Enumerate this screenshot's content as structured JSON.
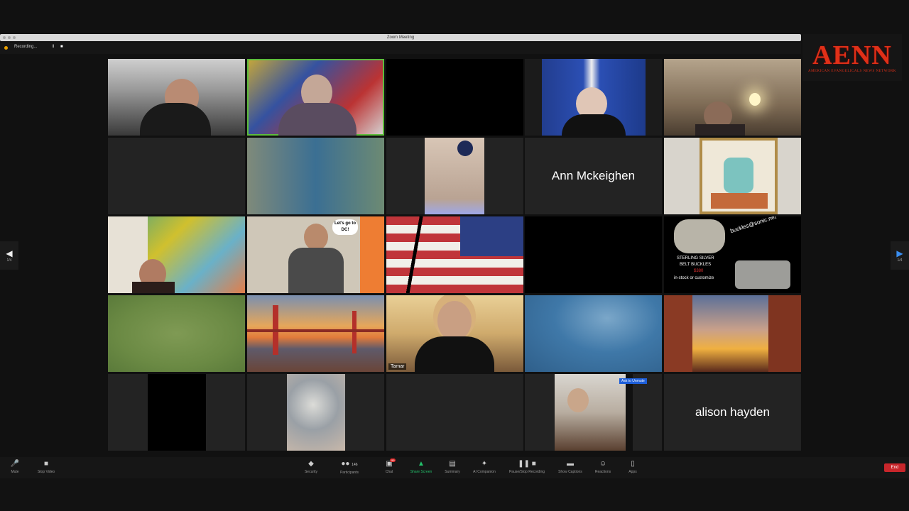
{
  "window": {
    "title": "Zoom Meeting"
  },
  "recording": {
    "label": "Recording...",
    "pause": "‖",
    "stop": "■"
  },
  "logo": {
    "text": "AENN",
    "subtitle": "AMERICAN EVANGELICALS NEWS NETWORK"
  },
  "participants": {
    "ann": "Ann Mckeighen",
    "alison": "alison hayden",
    "tamar_tag": "Tamar",
    "buckle_email": "buckles@sonic.net",
    "buckle_line1": "STERLING SILVER",
    "buckle_line2": "BELT BUCKLES",
    "buckle_price": "$380",
    "buckle_line3": "in-stock or customize",
    "sign_text": "Let's go to DC!",
    "ask_unmute": "Ask to Unmute"
  },
  "nav": {
    "prev_page": "1/4",
    "next_page": "1/4"
  },
  "toolbar": {
    "mute": "Mute",
    "stop_video": "Stop Video",
    "security": "Security",
    "participants": "Participants",
    "participants_count": "146",
    "chat": "Chat",
    "share_screen": "Share Screen",
    "summary": "Summary",
    "ai_companion": "AI Companion",
    "pause_recording": "Pause/Stop Recording",
    "show_captions": "Show Captions",
    "reactions": "Reactions",
    "apps": "Apps",
    "end": "End",
    "chat_badge": "99"
  },
  "colors": {
    "accent": "#23c26b",
    "end": "#c8262b",
    "logo": "#e03018",
    "active_border": "#5dbd3b"
  }
}
